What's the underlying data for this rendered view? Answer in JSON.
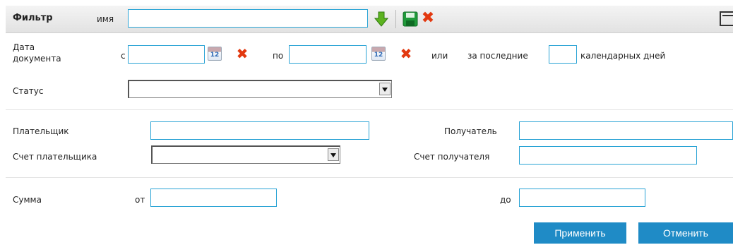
{
  "header": {
    "title": "Фильтр",
    "name_label": "имя",
    "name_value": ""
  },
  "date": {
    "label_line1": "Дата",
    "label_line2": "документа",
    "from_label": "с",
    "from_value": "",
    "calendar_text": "12",
    "to_label": "по",
    "to_value": "",
    "or_label": "или",
    "last_label": "за последние",
    "last_value": "",
    "days_label": "календарных дней"
  },
  "status": {
    "label": "Статус",
    "selected": ""
  },
  "payer": {
    "label": "Плательщик",
    "value": "",
    "account_label": "Счет плательщика",
    "account_selected": ""
  },
  "recipient": {
    "label": "Получатель",
    "value": "",
    "account_label": "Счет получателя",
    "account_value": ""
  },
  "amount": {
    "label": "Сумма",
    "from_label": "от",
    "from_value": "",
    "to_label": "до",
    "to_value": ""
  },
  "buttons": {
    "apply": "Применить",
    "cancel": "Отменить"
  },
  "colors": {
    "accent": "#1f8bc6",
    "field_border": "#29a3d5",
    "delete_red": "#e2380f",
    "download_green": "#5db320",
    "save_green": "#1f9a3a"
  }
}
